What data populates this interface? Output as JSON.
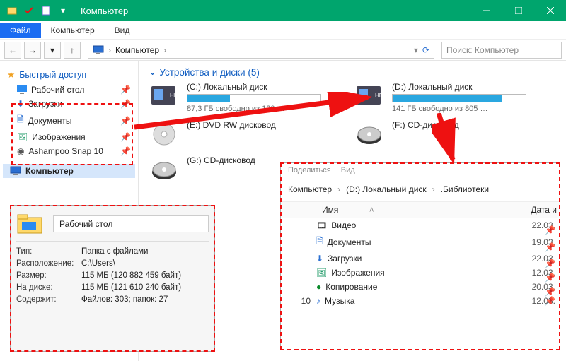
{
  "window": {
    "title": "Компьютер"
  },
  "menubar": {
    "file": "Файл",
    "computer": "Компьютер",
    "view": "Вид"
  },
  "breadcrumb": {
    "root": "Компьютер"
  },
  "search": {
    "placeholder": "Поиск: Компьютер"
  },
  "sidebar": {
    "quick": "Быстрый доступ",
    "items": [
      {
        "label": "Рабочий стол"
      },
      {
        "label": "Загрузки"
      },
      {
        "label": "Документы"
      },
      {
        "label": "Изображения"
      },
      {
        "label": "Ashampoo Snap 10"
      }
    ],
    "computer": "Компьютер"
  },
  "section": {
    "title": "Устройства и диски (5)"
  },
  "drives": {
    "c": {
      "name": "(C:) Локальный диск",
      "info": "87,3 ГБ свободно из 120 …",
      "fill": 32
    },
    "d": {
      "name": "(D:) Локальный диск",
      "info": "141 ГБ свободно из 805 …",
      "fill": 82
    },
    "e": {
      "name": "(E:) DVD RW дисковод"
    },
    "f": {
      "name": "(F:) CD-дисковод"
    },
    "g": {
      "name": "(G:) CD-дисковод"
    }
  },
  "props": {
    "name": "Рабочий стол",
    "rows": {
      "type_l": "Тип:",
      "type_v": "Папка с файлами",
      "loc_l": "Расположение:",
      "loc_v": "C:\\Users\\",
      "size_l": "Размер:",
      "size_v": "115 МБ (120 882 459 байт)",
      "disk_l": "На диске:",
      "disk_v": "115 МБ (121 610 240 байт)",
      "cont_l": "Содержит:",
      "cont_v": "Файлов: 303; папок: 27"
    }
  },
  "subwin": {
    "tabs": {
      "share": "Поделиться",
      "view": "Вид"
    },
    "crumbs": {
      "a": "Компьютер",
      "b": "(D:) Локальный диск",
      "c": ".Библиотеки"
    },
    "cols": {
      "name": "Имя",
      "date": "Дата и"
    },
    "count": "10",
    "rows": [
      {
        "label": "Видео",
        "date": "22.03."
      },
      {
        "label": "Документы",
        "date": "19.03."
      },
      {
        "label": "Загрузки",
        "date": "22.03."
      },
      {
        "label": "Изображения",
        "date": "12.03."
      },
      {
        "label": "Копирование",
        "date": "20.03."
      },
      {
        "label": "Музыка",
        "date": "12.03."
      }
    ]
  }
}
